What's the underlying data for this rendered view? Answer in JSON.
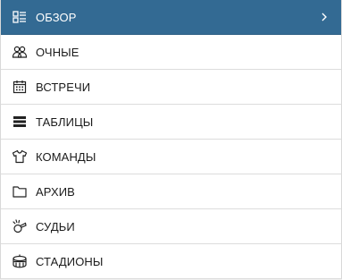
{
  "menu": {
    "items": [
      {
        "label": "ОБЗОР",
        "icon": "overview-icon",
        "active": true
      },
      {
        "label": "ОЧНЫЕ",
        "icon": "head-to-head-icon",
        "active": false
      },
      {
        "label": "ВСТРЕЧИ",
        "icon": "calendar-icon",
        "active": false
      },
      {
        "label": "ТАБЛИЦЫ",
        "icon": "table-icon",
        "active": false
      },
      {
        "label": "КОМАНДЫ",
        "icon": "shirt-icon",
        "active": false
      },
      {
        "label": "АРХИВ",
        "icon": "folder-icon",
        "active": false
      },
      {
        "label": "СУДЬИ",
        "icon": "whistle-icon",
        "active": false
      },
      {
        "label": "СТАДИОНЫ",
        "icon": "stadium-icon",
        "active": false
      }
    ]
  },
  "colors": {
    "active_bg": "#336a93",
    "text": "#1c1c1c",
    "divider": "#dcdcdc"
  }
}
